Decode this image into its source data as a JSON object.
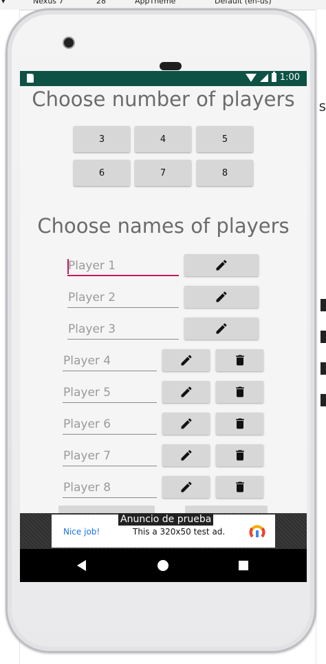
{
  "ide": {
    "device_label": "Nexus 7",
    "api_label": "28",
    "theme_label": "AppTheme",
    "locale_label": "Default (en-us)",
    "side_letter": "s"
  },
  "status_bar": {
    "time": "1:00",
    "background": "#0d5245"
  },
  "headings": {
    "number": "Choose number of players",
    "names": "Choose names of players"
  },
  "player_counts": [
    "3",
    "4",
    "5",
    "6",
    "7",
    "8"
  ],
  "players": [
    {
      "placeholder": "Player 1",
      "has_delete": false,
      "focused": true
    },
    {
      "placeholder": "Player 2",
      "has_delete": false,
      "focused": false
    },
    {
      "placeholder": "Player 3",
      "has_delete": false,
      "focused": false
    },
    {
      "placeholder": "Player 4",
      "has_delete": true,
      "focused": false
    },
    {
      "placeholder": "Player 5",
      "has_delete": true,
      "focused": false
    },
    {
      "placeholder": "Player 6",
      "has_delete": true,
      "focused": false
    },
    {
      "placeholder": "Player 7",
      "has_delete": true,
      "focused": false
    },
    {
      "placeholder": "Player 8",
      "has_delete": true,
      "focused": false
    }
  ],
  "icons": {
    "edit": "pencil-icon",
    "delete": "trash-icon"
  },
  "ad": {
    "label": "Anuncio de prueba",
    "nice_job": "Nice job!",
    "text": "This a 320x50 test ad."
  },
  "colors": {
    "accent": "#c2185b",
    "button_bg": "#d7d7d7",
    "heading_text": "#6b6b6b"
  }
}
